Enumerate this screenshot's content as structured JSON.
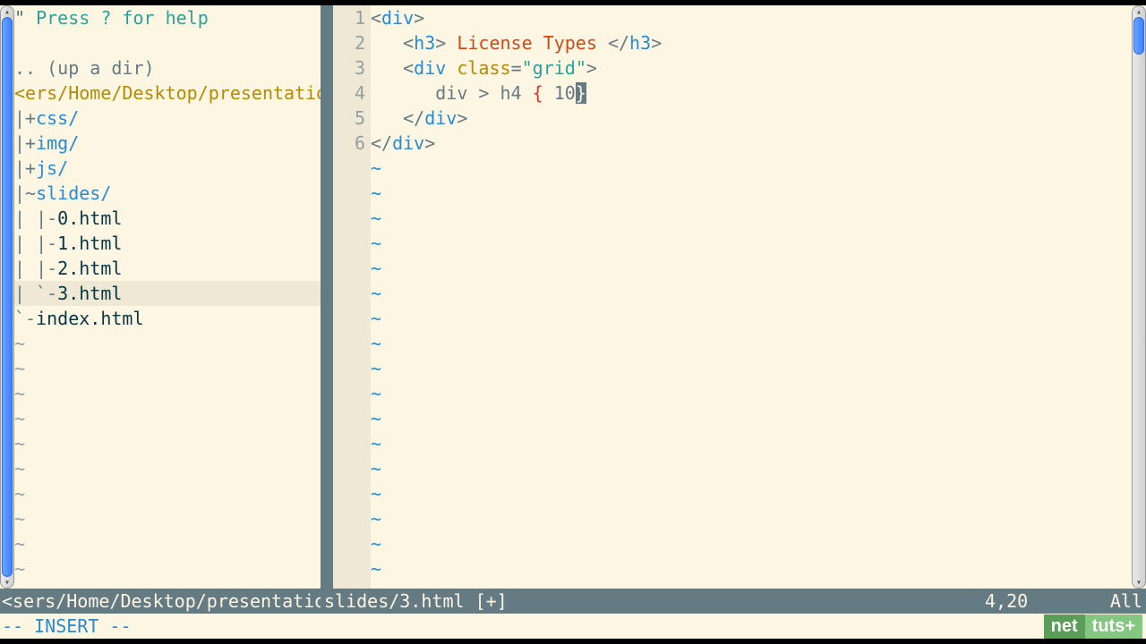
{
  "tree": {
    "help_quote": "\"",
    "help_text": " Press ? for help",
    "updir": ".. (up a dir)",
    "root_path": "<ers/Home/Desktop/presentation/",
    "items": [
      {
        "prefix": "|+",
        "label": "css/",
        "type": "dir"
      },
      {
        "prefix": "|+",
        "label": "img/",
        "type": "dir"
      },
      {
        "prefix": "|+",
        "label": "js/",
        "type": "dir"
      },
      {
        "prefix": "|~",
        "label": "slides/",
        "type": "dir"
      },
      {
        "prefix": "| |-",
        "label": "0.html",
        "type": "file"
      },
      {
        "prefix": "| |-",
        "label": "1.html",
        "type": "file"
      },
      {
        "prefix": "| |-",
        "label": "2.html",
        "type": "file"
      },
      {
        "prefix": "| `-",
        "label": "3.html",
        "type": "file",
        "selected": true
      },
      {
        "prefix": "`-",
        "label": "index.html",
        "type": "file"
      }
    ]
  },
  "editor": {
    "lines": [
      {
        "n": 1,
        "tokens": [
          {
            "t": "<",
            "c": "t-angle"
          },
          {
            "t": "div",
            "c": "t-tag"
          },
          {
            "t": ">",
            "c": "t-angle"
          }
        ]
      },
      {
        "n": 2,
        "tokens": [
          {
            "t": "   ",
            "c": "t-plain"
          },
          {
            "t": "<",
            "c": "t-angle"
          },
          {
            "t": "h3",
            "c": "t-tag"
          },
          {
            "t": ">",
            "c": "t-angle"
          },
          {
            "t": " License Types ",
            "c": "t-text"
          },
          {
            "t": "</",
            "c": "t-angle"
          },
          {
            "t": "h3",
            "c": "t-tag"
          },
          {
            "t": ">",
            "c": "t-angle"
          }
        ]
      },
      {
        "n": 3,
        "tokens": [
          {
            "t": "   ",
            "c": "t-plain"
          },
          {
            "t": "<",
            "c": "t-angle"
          },
          {
            "t": "div",
            "c": "t-tag"
          },
          {
            "t": " ",
            "c": "t-plain"
          },
          {
            "t": "class",
            "c": "t-attr"
          },
          {
            "t": "=",
            "c": "t-plain"
          },
          {
            "t": "\"grid\"",
            "c": "t-str"
          },
          {
            "t": ">",
            "c": "t-angle"
          }
        ]
      },
      {
        "n": 4,
        "tokens": [
          {
            "t": "      div > h4 ",
            "c": "t-plain"
          },
          {
            "t": "{",
            "c": "t-brace"
          },
          {
            "t": " 10",
            "c": "t-plain"
          },
          {
            "t": "}",
            "c": "cursor-hl"
          }
        ]
      },
      {
        "n": 5,
        "tokens": [
          {
            "t": "   ",
            "c": "t-plain"
          },
          {
            "t": "</",
            "c": "t-angle"
          },
          {
            "t": "div",
            "c": "t-tag"
          },
          {
            "t": ">",
            "c": "t-angle"
          }
        ]
      },
      {
        "n": 6,
        "tokens": [
          {
            "t": "</",
            "c": "t-angle"
          },
          {
            "t": "div",
            "c": "t-tag"
          },
          {
            "t": ">",
            "c": "t-angle"
          }
        ]
      }
    ],
    "empty_lines": 17
  },
  "status": {
    "tree_segment": "<sers/Home/Desktop/presentation",
    "file_segment": "slides/3.html [+]",
    "position": "4,20",
    "percent": "All"
  },
  "cmdline": "-- INSERT --",
  "watermark": {
    "left": "net",
    "right": "tuts+"
  }
}
